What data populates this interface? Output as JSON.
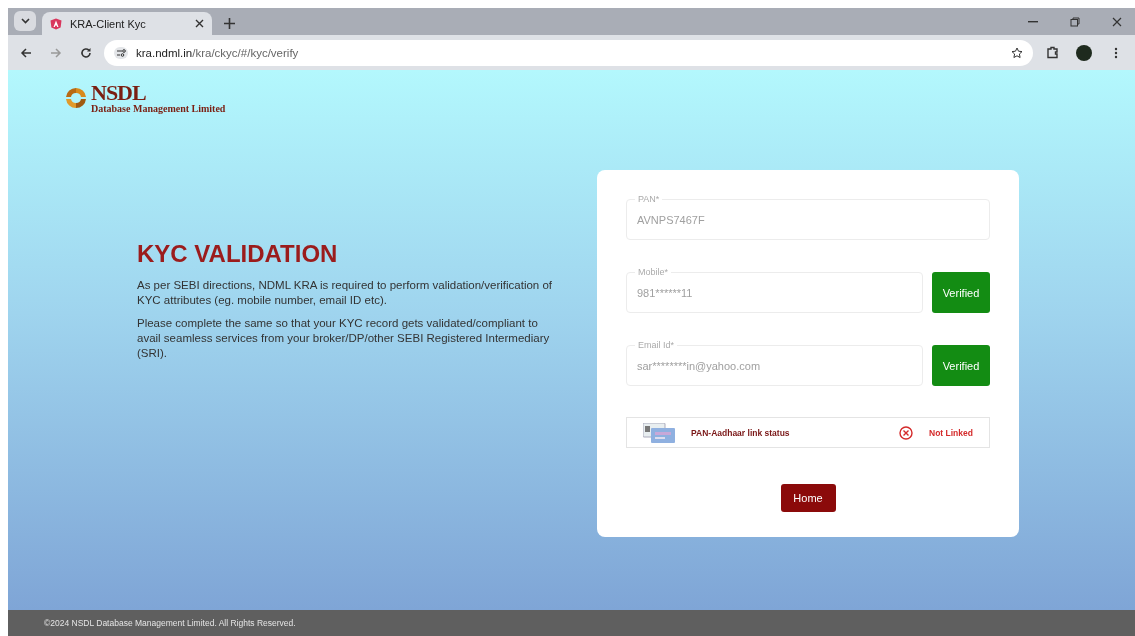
{
  "browser": {
    "tab_title": "KRA-Client Kyc",
    "url_host": "kra.ndml.in",
    "url_path": "/kra/ckyc/#/kyc/verify"
  },
  "logo": {
    "name": "NSDL",
    "subtitle": "Database Management Limited"
  },
  "intro": {
    "title": "KYC VALIDATION",
    "paragraphs": [
      "As per SEBI directions, NDML KRA is required to perform validation/verification of KYC attributes (eg. mobile number, email ID etc).",
      "Please complete the same so that your KYC record gets validated/compliant to avail seamless services from your broker/DP/other SEBI Registered Intermediary (SRI)."
    ]
  },
  "form": {
    "fields": [
      {
        "label": "PAN*",
        "value": "AVNPS7467F"
      },
      {
        "label": "Mobile*",
        "value": "981******11",
        "button": "Verified"
      },
      {
        "label": "Email Id*",
        "value": "sar********in@yahoo.com",
        "button": "Verified"
      }
    ],
    "link_status": {
      "label": "PAN-Aadhaar link status",
      "linked": false,
      "status": "Not Linked"
    },
    "home_button": "Home"
  },
  "footer": "©2024 NSDL Database Management Limited. All Rights Reserved."
}
